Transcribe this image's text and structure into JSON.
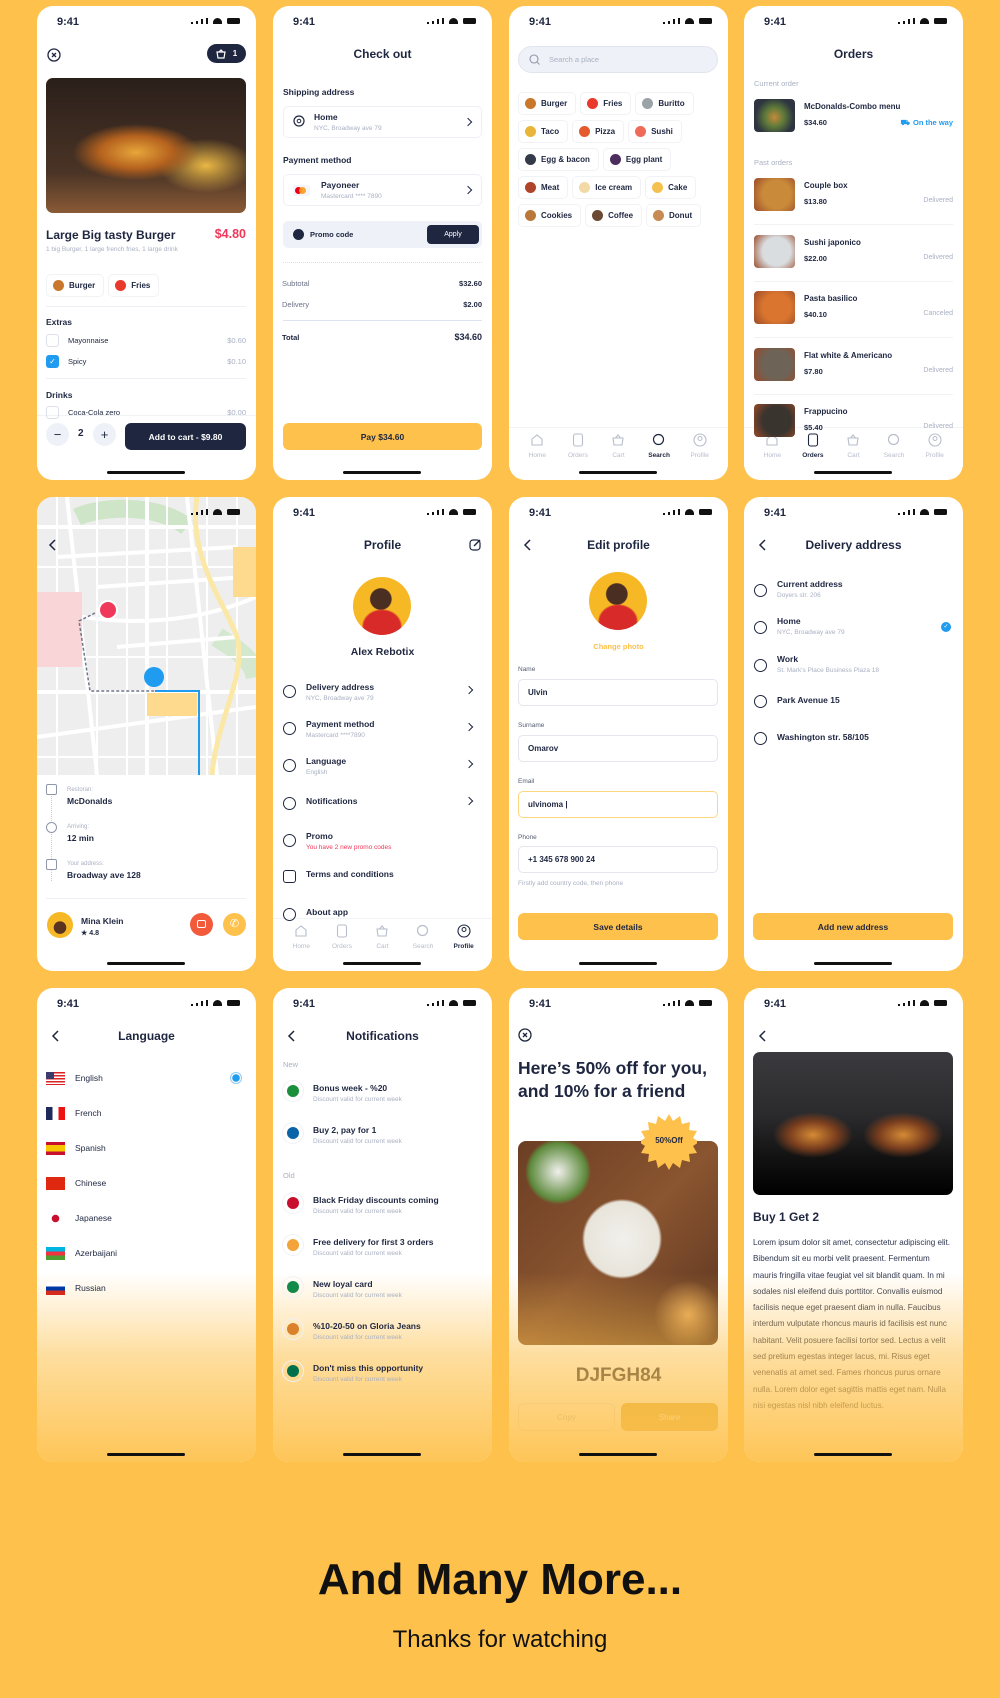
{
  "status_time": "9:41",
  "colors": {
    "background": "#FEC14B",
    "dark": "#1E2640",
    "accent_red": "#F0385A",
    "accent_blue": "#1F9BF0",
    "yellow": "#FEC14B"
  },
  "nav": [
    {
      "label": "Home",
      "icon": "home-icon"
    },
    {
      "label": "Orders",
      "icon": "orders-icon"
    },
    {
      "label": "Cart",
      "icon": "cart-icon"
    },
    {
      "label": "Search",
      "icon": "search-icon"
    },
    {
      "label": "Profile",
      "icon": "profile-icon"
    }
  ],
  "product": {
    "cart_count": "1",
    "title": "Large Big tasty Burger",
    "price": "$4.80",
    "description": "1 big Burger, 1 large french fries, 1 large drink",
    "chips": [
      {
        "label": "Burger",
        "icon": "burger-icon",
        "color": "#C9782B"
      },
      {
        "label": "Fries",
        "icon": "fries-icon",
        "color": "#E8392B"
      }
    ],
    "extras_label": "Extras",
    "extras": [
      {
        "name": "Mayonnaise",
        "price": "$0.60",
        "checked": false
      },
      {
        "name": "Spicy",
        "price": "$0.10",
        "checked": true
      }
    ],
    "drinks_label": "Drinks",
    "drinks": [
      {
        "name": "Coca-Cola zero",
        "price": "$0.00",
        "checked": false
      }
    ],
    "quantity": "2",
    "add_to_cart": "Add to cart - $9.80"
  },
  "checkout": {
    "title": "Check out",
    "shipping_label": "Shipping address",
    "address_title": "Home",
    "address_sub": "NYC, Broadway ave 79",
    "payment_label": "Payment method",
    "payment_title": "Payoneer",
    "payment_sub": "Mastercard **** 7890",
    "promo_label": "Promo code",
    "apply": "Apply",
    "subtotal_label": "Subtotal",
    "subtotal": "$32.60",
    "delivery_label": "Delivery",
    "delivery": "$2.00",
    "total_label": "Total",
    "total": "$34.60",
    "pay": "Pay $34.60"
  },
  "search": {
    "placeholder": "Search a place",
    "chips": [
      {
        "label": "Burger",
        "icon": "burger-icon",
        "color": "#C9782B"
      },
      {
        "label": "Fries",
        "icon": "fries-icon",
        "color": "#E8392B"
      },
      {
        "label": "Buritto",
        "icon": "burrito-icon",
        "color": "#9AA3A8"
      },
      {
        "label": "Taco",
        "icon": "taco-icon",
        "color": "#E8B43A"
      },
      {
        "label": "Pizza",
        "icon": "pizza-icon",
        "color": "#E45A2C"
      },
      {
        "label": "Sushi",
        "icon": "sushi-icon",
        "color": "#F06A5A"
      },
      {
        "label": "Egg & bacon",
        "icon": "egg-bacon-icon",
        "color": "#333B4A"
      },
      {
        "label": "Egg plant",
        "icon": "eggplant-icon",
        "color": "#4B2E5E"
      },
      {
        "label": "Meat",
        "icon": "meat-icon",
        "color": "#B0442A"
      },
      {
        "label": "Ice cream",
        "icon": "ice-cream-icon",
        "color": "#F2D9A6"
      },
      {
        "label": "Cake",
        "icon": "cake-icon",
        "color": "#F4C04E"
      },
      {
        "label": "Cookies",
        "icon": "cookies-icon",
        "color": "#B9773A"
      },
      {
        "label": "Coffee",
        "icon": "coffee-icon",
        "color": "#6B4A33"
      },
      {
        "label": "Donut",
        "icon": "donut-icon",
        "color": "#C88A54"
      }
    ],
    "active_nav": 3
  },
  "orders": {
    "title": "Orders",
    "current_label": "Current order",
    "current": {
      "name": "McDonalds-Combo menu",
      "price": "$34.60",
      "status": "On the way"
    },
    "past_label": "Past orders",
    "past": [
      {
        "name": "Couple box",
        "price": "$13.80",
        "status": "Delivered",
        "color": "#C98A3A"
      },
      {
        "name": "Sushi japonico",
        "price": "$22.00",
        "status": "Delivered",
        "color": "#D9DDE0"
      },
      {
        "name": "Pasta basilico",
        "price": "$40.10",
        "status": "Canceled",
        "color": "#D9752F"
      },
      {
        "name": "Flat white & Americano",
        "price": "$7.80",
        "status": "Delivered",
        "color": "#6E6357"
      },
      {
        "name": "Frappucino",
        "price": "$5.40",
        "status": "Delivered",
        "color": "#3A342E"
      }
    ],
    "active_nav": 1
  },
  "tracking": {
    "restaurant_label": "Restoran:",
    "restaurant": "McDonalds",
    "arriving_label": "Arriving:",
    "arriving": "12 min",
    "address_label": "Your address:",
    "address": "Broadway ave 128",
    "driver_name": "Mina Klein",
    "driver_rating": "4.8"
  },
  "profile": {
    "title": "Profile",
    "name": "Alex Rebotix",
    "menu": [
      {
        "title": "Delivery address",
        "sub": "NYC, Broadway ave 79",
        "icon": "location-pin-icon",
        "chevron": true
      },
      {
        "title": "Payment method",
        "sub": "Mastercard ****7890",
        "icon": "wallet-icon",
        "chevron": true
      },
      {
        "title": "Language",
        "sub": "English",
        "icon": "language-icon",
        "chevron": true
      },
      {
        "title": "Notifications",
        "sub": "",
        "icon": "bell-icon",
        "chevron": true
      },
      {
        "title": "Promo",
        "sub": "You have 2 new promo codes",
        "icon": "promo-icon",
        "chevron": false,
        "sub_red": true
      },
      {
        "title": "Terms and conditions",
        "sub": "",
        "icon": "document-icon",
        "chevron": false
      },
      {
        "title": "About app",
        "sub": "",
        "icon": "info-icon",
        "chevron": false
      }
    ],
    "active_nav": 4
  },
  "edit_profile": {
    "title": "Edit profile",
    "change_photo": "Change photo",
    "name_label": "Name",
    "name": "Ulvin",
    "surname_label": "Surname",
    "surname": "Omarov",
    "email_label": "Email",
    "email": "ulvinoma |",
    "phone_label": "Phone",
    "phone": "+1 345 678 900 24",
    "phone_hint": "Firstly add country code, then phone",
    "save": "Save details"
  },
  "delivery": {
    "title": "Delivery address",
    "addresses": [
      {
        "title": "Current address",
        "sub": "Doyers str. 206",
        "icon": "target-icon",
        "selected": false
      },
      {
        "title": "Home",
        "sub": "NYC, Broadway ave 79",
        "icon": "location-pin-icon",
        "selected": true
      },
      {
        "title": "Work",
        "sub": "St. Mark's Place Business Plaza 18",
        "icon": "location-pin-icon",
        "selected": false
      },
      {
        "title": "Park Avenue 15",
        "sub": "",
        "icon": "location-pin-icon",
        "selected": false
      },
      {
        "title": "Washington str. 58/105",
        "sub": "",
        "icon": "location-pin-icon",
        "selected": false
      }
    ],
    "add": "Add new address"
  },
  "language": {
    "title": "Language",
    "items": [
      {
        "label": "English",
        "flag": "us-flag-icon",
        "selected": true
      },
      {
        "label": "French",
        "flag": "france-flag-icon",
        "selected": false
      },
      {
        "label": "Spanish",
        "flag": "spain-flag-icon",
        "selected": false
      },
      {
        "label": "Chinese",
        "flag": "china-flag-icon",
        "selected": false
      },
      {
        "label": "Japanese",
        "flag": "japan-flag-icon",
        "selected": false
      },
      {
        "label": "Azerbaijani",
        "flag": "azerbaijan-flag-icon",
        "selected": false
      },
      {
        "label": "Russian",
        "flag": "russia-flag-icon",
        "selected": false
      }
    ]
  },
  "notifications": {
    "title": "Notifications",
    "new_label": "New",
    "new": [
      {
        "title": "Bonus week - %20",
        "sub": "Discount valid for current week",
        "logo": "subway-logo-icon",
        "color": "#1A8F3C"
      },
      {
        "title": "Buy 2, pay for 1",
        "sub": "Discount valid for current week",
        "logo": "dominos-logo-icon",
        "color": "#0B64A8"
      }
    ],
    "old_label": "Old",
    "old": [
      {
        "title": "Black Friday discounts coming",
        "sub": "Discount valid for current week",
        "logo": "pizza-hut-logo-icon",
        "color": "#C8102E"
      },
      {
        "title": "Free delivery for first 3 orders",
        "sub": "Discount valid for current week",
        "logo": "burger-king-logo-icon",
        "color": "#F2A33A"
      },
      {
        "title": "New loyal card",
        "sub": "Discount valid for current week",
        "logo": "seven-eleven-logo-icon",
        "color": "#138A4A"
      },
      {
        "title": "%10-20-50 on Gloria Jeans",
        "sub": "Discount valid for current week",
        "logo": "gloria-jeans-logo-icon",
        "color": "#D9822B"
      },
      {
        "title": "Don't miss this opportunity",
        "sub": "Discount valid for current week",
        "logo": "starbucks-logo-icon",
        "color": "#00704A"
      }
    ]
  },
  "promo": {
    "headline": "Here’s 50% off for you, and 10% for a friend",
    "badge": "50%Off",
    "code": "DJFGH84",
    "copy": "Copy",
    "share": "Share"
  },
  "offer": {
    "title": "Buy 1 Get 2",
    "body": "Lorem ipsum dolor sit amet, consectetur adipiscing elit. Bibendum sit eu morbi velit praesent. Fermentum mauris fringilla vitae feugiat vel sit blandit quam. In mi sodales nisl eleifend duis porttitor. Convallis euismod facilisis neque eget praesent diam in nulla. Faucibus interdum vulputate rhoncus mauris id facilisis est nunc habitant. Velit posuere facilisi tortor sed. Lectus a velit sed pretium egestas integer lacus, mi. Risus eget venenatis at amet sed. Fames rhoncus purus ornare nulla. Lorem dolor eget sagittis mattis eget nam. Nulla nisi egestas nisl nibh eleifend luctus."
  },
  "footer": {
    "headline": "And Many More...",
    "subline": "Thanks for watching"
  }
}
